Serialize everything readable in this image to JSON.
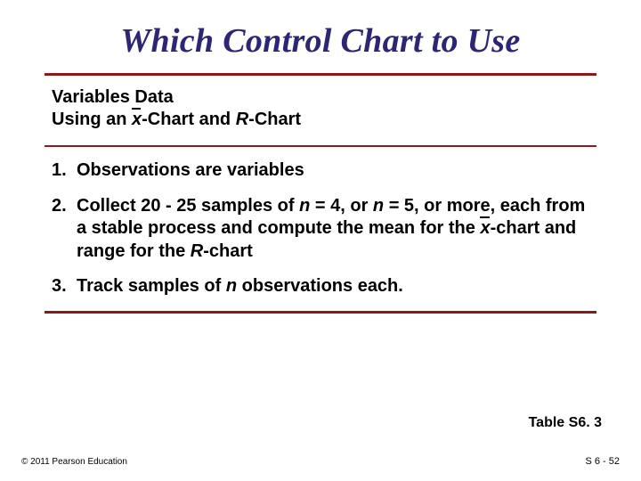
{
  "title": "Which Control Chart to Use",
  "subhead": {
    "line1": "Variables Data",
    "line2_pre": "Using an ",
    "line2_xbar": "x",
    "line2_mid": "-Chart and ",
    "line2_r": "R",
    "line2_post": "-Chart"
  },
  "items": [
    {
      "num": "1.",
      "text": "Observations are variables"
    },
    {
      "num": "2.",
      "pre": "Collect 20 - 25 samples of ",
      "n1_lbl": "n",
      "eq1": " = 4, or ",
      "n2_lbl": "n",
      "eq2": " = 5, or more, each from a stable process and compute the mean for the ",
      "xbar": "x",
      "mid": "-chart and range for the ",
      "r_lbl": "R",
      "post": "-chart"
    },
    {
      "num": "3.",
      "pre": "Track samples of ",
      "n_lbl": "n",
      "post": " observations each."
    }
  ],
  "table_ref": "Table S6. 3",
  "footer_left": "© 2011 Pearson Education",
  "footer_right": "S 6 - 52"
}
